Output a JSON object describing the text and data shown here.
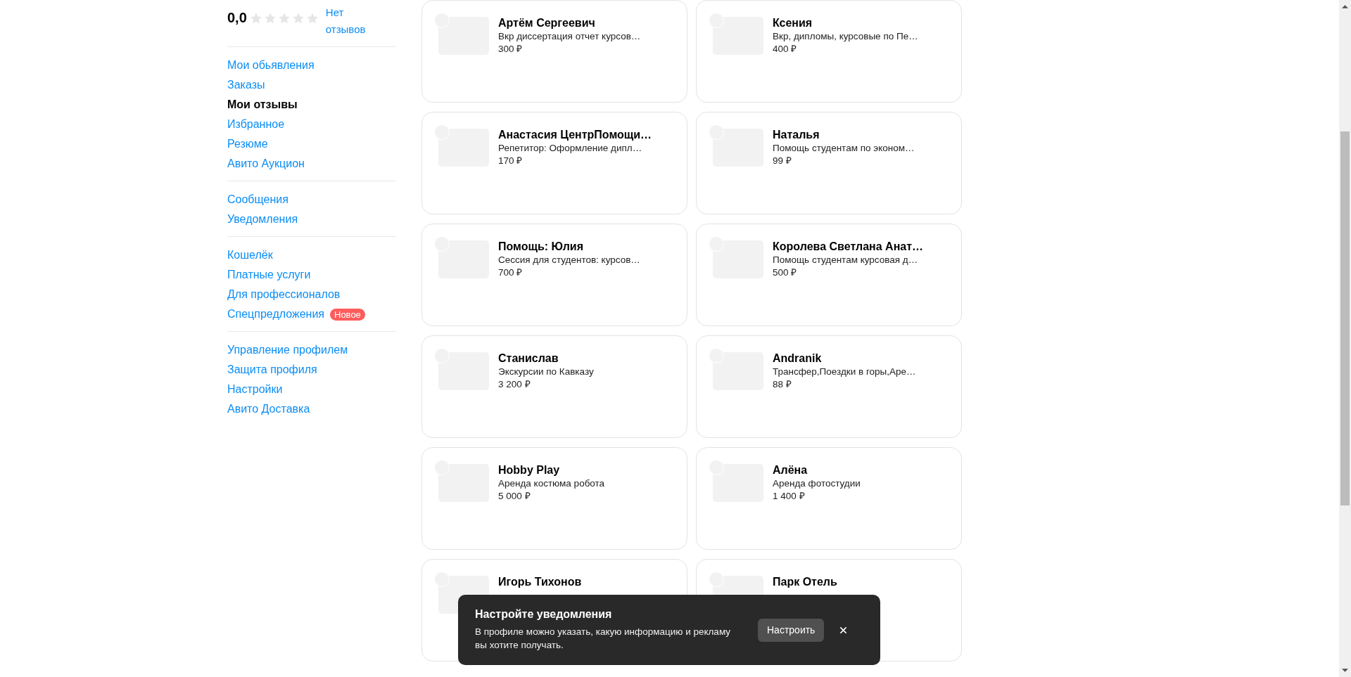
{
  "rating": {
    "value": "0,0",
    "stars": 0,
    "reviews_link": "Нет отзывов"
  },
  "menu_groups": [
    {
      "items": [
        {
          "label": "Мои обьявления",
          "selected": false
        },
        {
          "label": "Заказы",
          "selected": false
        },
        {
          "label": "Мои отзывы",
          "selected": true
        },
        {
          "label": "Избранное",
          "selected": false
        },
        {
          "label": "Резюме",
          "selected": false
        },
        {
          "label": "Авито Аукцион",
          "selected": false
        }
      ]
    },
    {
      "items": [
        {
          "label": "Сообщения",
          "selected": false
        },
        {
          "label": "Уведомления",
          "selected": false
        }
      ]
    },
    {
      "items": [
        {
          "label": "Кошелёк",
          "selected": false
        },
        {
          "label": "Платные услуги",
          "selected": false
        },
        {
          "label": "Для профессионалов",
          "selected": false
        },
        {
          "label": "Спецпредложения",
          "selected": false,
          "badge": "Новое"
        }
      ]
    },
    {
      "items": [
        {
          "label": "Управление профилем",
          "selected": false
        },
        {
          "label": "Защита профиля",
          "selected": false
        },
        {
          "label": "Настройки",
          "selected": false
        },
        {
          "label": "Авито Доставка",
          "selected": false
        }
      ]
    }
  ],
  "cards": [
    {
      "name": "Артём Сергеевич",
      "description": "Вкр диссертация отчет курсов…",
      "price": "300 ₽",
      "checked": false
    },
    {
      "name": "Ксения",
      "description": "Вкр, дипломы, курсовые по Пе…",
      "price": "400 ₽",
      "checked": false
    },
    {
      "name": "Анастасия ЦентрПомощи…",
      "description": "Репетитор: Оформление дипл…",
      "price": "170 ₽",
      "checked": false
    },
    {
      "name": "Наталья",
      "description": "Помощь студентам по эконом…",
      "price": "99 ₽",
      "checked": false
    },
    {
      "name": "Помощь: Юлия",
      "description": "Сессия для студентов: курсов…",
      "price": "700 ₽",
      "checked": false
    },
    {
      "name": "Королева Светлана Анат…",
      "description": "Помощь студентам курсовая д…",
      "price": "500 ₽",
      "checked": false
    },
    {
      "name": "Станислав",
      "description": "Экскурсии по Кавказу",
      "price": "3 200 ₽",
      "checked": false
    },
    {
      "name": "Andranik",
      "description": "Трансфер,Поездки в горы,Аре…",
      "price": "88 ₽",
      "checked": false
    },
    {
      "name": "Hobby Play",
      "description": "Аренда костюма робота",
      "price": "5 000 ₽",
      "checked": false
    },
    {
      "name": "Алёна",
      "description": "Аренда фотостудии",
      "price": "1 400 ₽",
      "checked": false
    },
    {
      "name": "Игорь Тихонов",
      "checked": false
    },
    {
      "name": "Парк Отель",
      "checked": false
    }
  ],
  "toast": {
    "title": "Настройте уведомления",
    "text": "В профиле можно указать, какую информацию и рекламу вы хотите получать.",
    "button": "Настроить"
  }
}
